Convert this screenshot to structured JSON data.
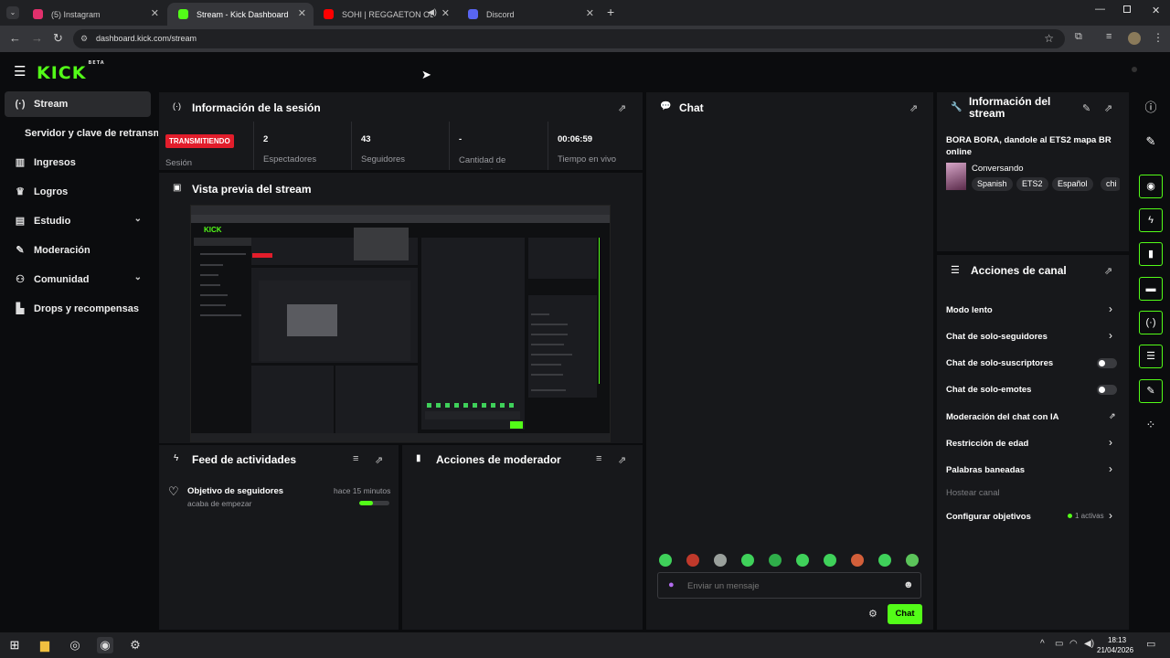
{
  "browser": {
    "tabs": [
      {
        "label": "(5) Instagram",
        "favicon_color": "#e1306c"
      },
      {
        "label": "Stream - Kick Dashboard",
        "favicon_color": "#53fc18"
      },
      {
        "label": "SOHI | REGGAETON OLD SC",
        "favicon_color": "#ff0000"
      },
      {
        "label": "Discord",
        "favicon_color": "#5865f2"
      }
    ],
    "url": "dashboard.kick.com/stream"
  },
  "app": {
    "logo": "KICK",
    "logo_badge": "BETA",
    "accent_color": "#53fc18"
  },
  "sidebar": {
    "items": [
      {
        "label": "Stream",
        "icon": "broadcast-icon"
      },
      {
        "label": "Servidor y clave de retransmisión"
      },
      {
        "label": "Ingresos",
        "icon": "chart-icon"
      },
      {
        "label": "Logros",
        "icon": "trophy-icon"
      },
      {
        "label": "Estudio",
        "icon": "studio-icon"
      },
      {
        "label": "Moderación",
        "icon": "wrench-icon"
      },
      {
        "label": "Comunidad",
        "icon": "community-icon"
      },
      {
        "label": "Drops y recompensas",
        "icon": "drops-icon"
      }
    ]
  },
  "session": {
    "title": "Información de la sesión",
    "live_badge": "TRANSMITIENDO",
    "session_label": "Sesión",
    "stats": [
      {
        "value": "2",
        "label": "Espectadores"
      },
      {
        "value": "43",
        "label": "Seguidores"
      },
      {
        "value": "-",
        "label": "Cantidad de suscripciones"
      },
      {
        "value": "00:06:59",
        "label": "Tiempo en vivo"
      }
    ]
  },
  "preview": {
    "title": "Vista previa del stream"
  },
  "activity": {
    "title": "Feed de actividades",
    "item_title": "Objetivo de seguidores",
    "item_sub": "acaba de empezar",
    "item_time": "hace 15 minutos",
    "progress": 0.45
  },
  "modactions": {
    "title": "Acciones de moderador"
  },
  "chat": {
    "title": "Chat",
    "placeholder": "Enviar un mensaje",
    "send_label": "Chat"
  },
  "streaminfo": {
    "title": "Información del stream",
    "stream_title": "BORA BORA, dandole al ETS2 mapa BR online",
    "category": "Conversando",
    "tags": [
      "Spanish",
      "ETS2",
      "Español",
      "chi"
    ]
  },
  "channel_actions": {
    "title": "Acciones de canal",
    "items": [
      {
        "label": "Modo lento"
      },
      {
        "label": "Chat de solo-seguidores"
      },
      {
        "label": "Chat de solo-suscriptores"
      },
      {
        "label": "Chat de solo-emotes"
      },
      {
        "label": "Moderación del chat con IA"
      },
      {
        "label": "Restricción de edad"
      },
      {
        "label": "Palabras baneadas"
      },
      {
        "label": "Hostear canal"
      },
      {
        "label": "Configurar objetivos"
      }
    ],
    "goals_badge": "1 activas"
  },
  "taskbar": {
    "time": "18:13",
    "date": "21/04/2026"
  }
}
